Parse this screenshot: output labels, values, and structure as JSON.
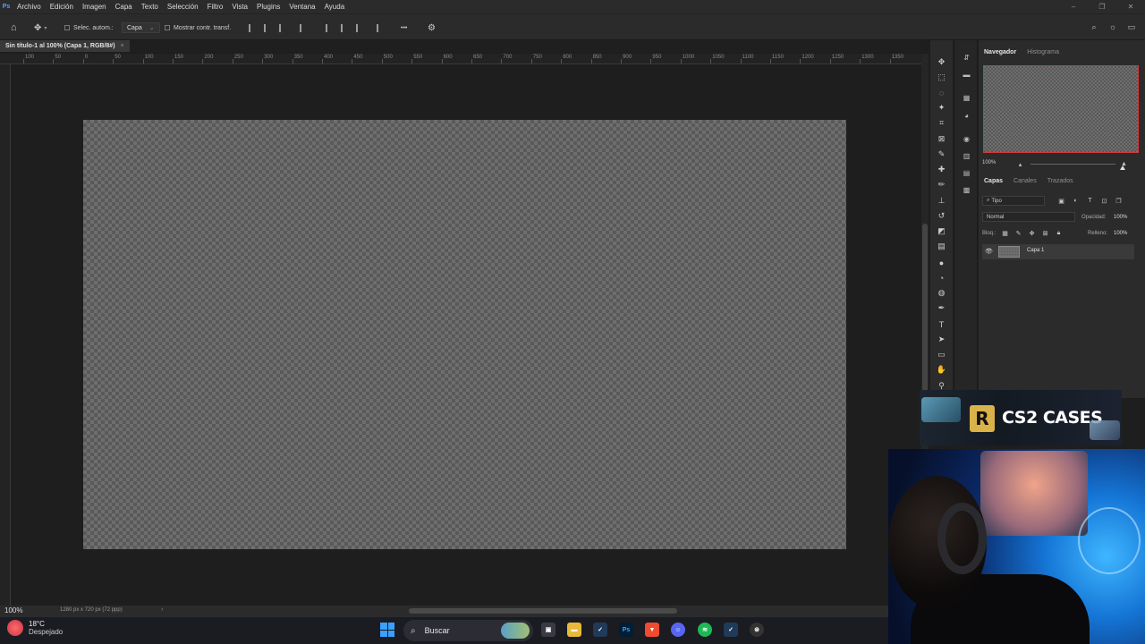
{
  "app": {
    "logo": "Ps",
    "menu": [
      "Archivo",
      "Edición",
      "Imagen",
      "Capa",
      "Texto",
      "Selección",
      "Filtro",
      "Vista",
      "Plugins",
      "Ventana",
      "Ayuda"
    ]
  },
  "options": {
    "auto_select_label": "Selec. autom.:",
    "auto_select_value": "Capa",
    "show_transform_label": "Mostrar contr. transf.",
    "more_label": "•••"
  },
  "document": {
    "tab_title": "Sin título-1 al 100% (Capa 1, RGB/8#)",
    "tab_close": "×",
    "zoom": "100%",
    "info": "1280 px x 720 px (72 ppp)",
    "ruler_labels": [
      "100",
      "50",
      "0",
      "50",
      "100",
      "150",
      "200",
      "250",
      "300",
      "350",
      "400",
      "450",
      "500",
      "550",
      "600",
      "650",
      "700",
      "750",
      "800",
      "850",
      "900",
      "950",
      "1000",
      "1050",
      "1100",
      "1150",
      "1200",
      "1250",
      "1300",
      "1350"
    ]
  },
  "navigator": {
    "tabs": [
      "Navegador",
      "Histograma"
    ],
    "zoom": "100%"
  },
  "layers": {
    "tabs": [
      "Capas",
      "Canales",
      "Trazados"
    ],
    "filter_label": "Tipo",
    "blend_mode": "Normal",
    "opacity_label": "Opacidad:",
    "opacity_value": "100%",
    "lock_label": "Bloq.:",
    "fill_label": "Relleno:",
    "fill_value": "100%",
    "items": [
      {
        "name": "Capa 1",
        "visible": true
      }
    ]
  },
  "overlay": {
    "banner_logo": "R",
    "banner_text": "CS2 CASES"
  },
  "taskbar": {
    "weather_temp": "18°C",
    "weather_condition": "Despejado",
    "search_label": "Buscar",
    "apps": [
      "Ps"
    ]
  },
  "colors": {
    "accent_blue": "#3aa0ff",
    "nav_frame": "#d23a3a",
    "banner_gold": "#d9b24a"
  }
}
